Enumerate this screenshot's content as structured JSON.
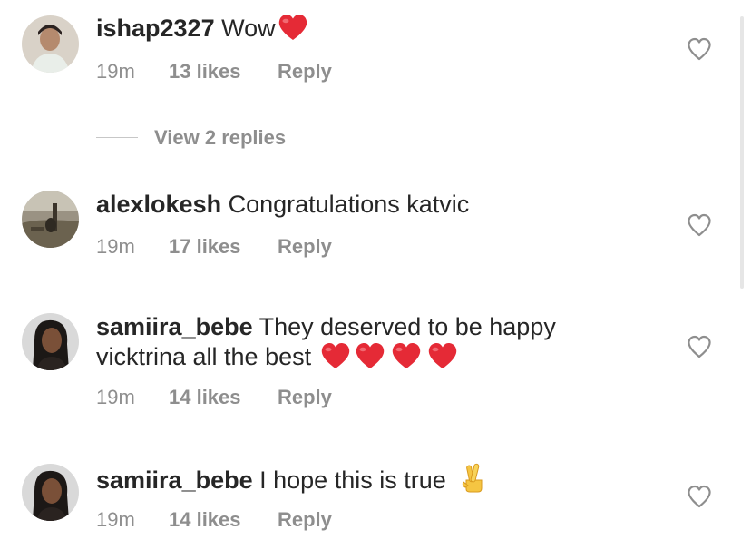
{
  "colors": {
    "text": "#262626",
    "secondary": "#8e8e8e",
    "heart_red": "#ed4956"
  },
  "comments": [
    {
      "username": "ishap2327",
      "text": "Wow",
      "time": "19m",
      "likes": "13 likes",
      "reply": "Reply",
      "emojis": [
        "red-heart"
      ]
    },
    {
      "username": "alexlokesh",
      "text": "Congratulations katvic",
      "time": "19m",
      "likes": "17 likes",
      "reply": "Reply",
      "emojis": []
    },
    {
      "username": "samiira_bebe",
      "text": "They deserved to be happy",
      "text_line2": "vicktrina all the best",
      "time": "19m",
      "likes": "14 likes",
      "reply": "Reply",
      "emojis": [
        "red-heart",
        "red-heart",
        "red-heart",
        "red-heart"
      ]
    },
    {
      "username": "samiira_bebe",
      "text": "I hope this is true",
      "time": "19m",
      "likes": "14 likes",
      "reply": "Reply",
      "emojis": [
        "crossed-fingers"
      ]
    }
  ],
  "view_replies": "View 2 replies",
  "icons": {
    "like": "heart-outline-icon"
  }
}
